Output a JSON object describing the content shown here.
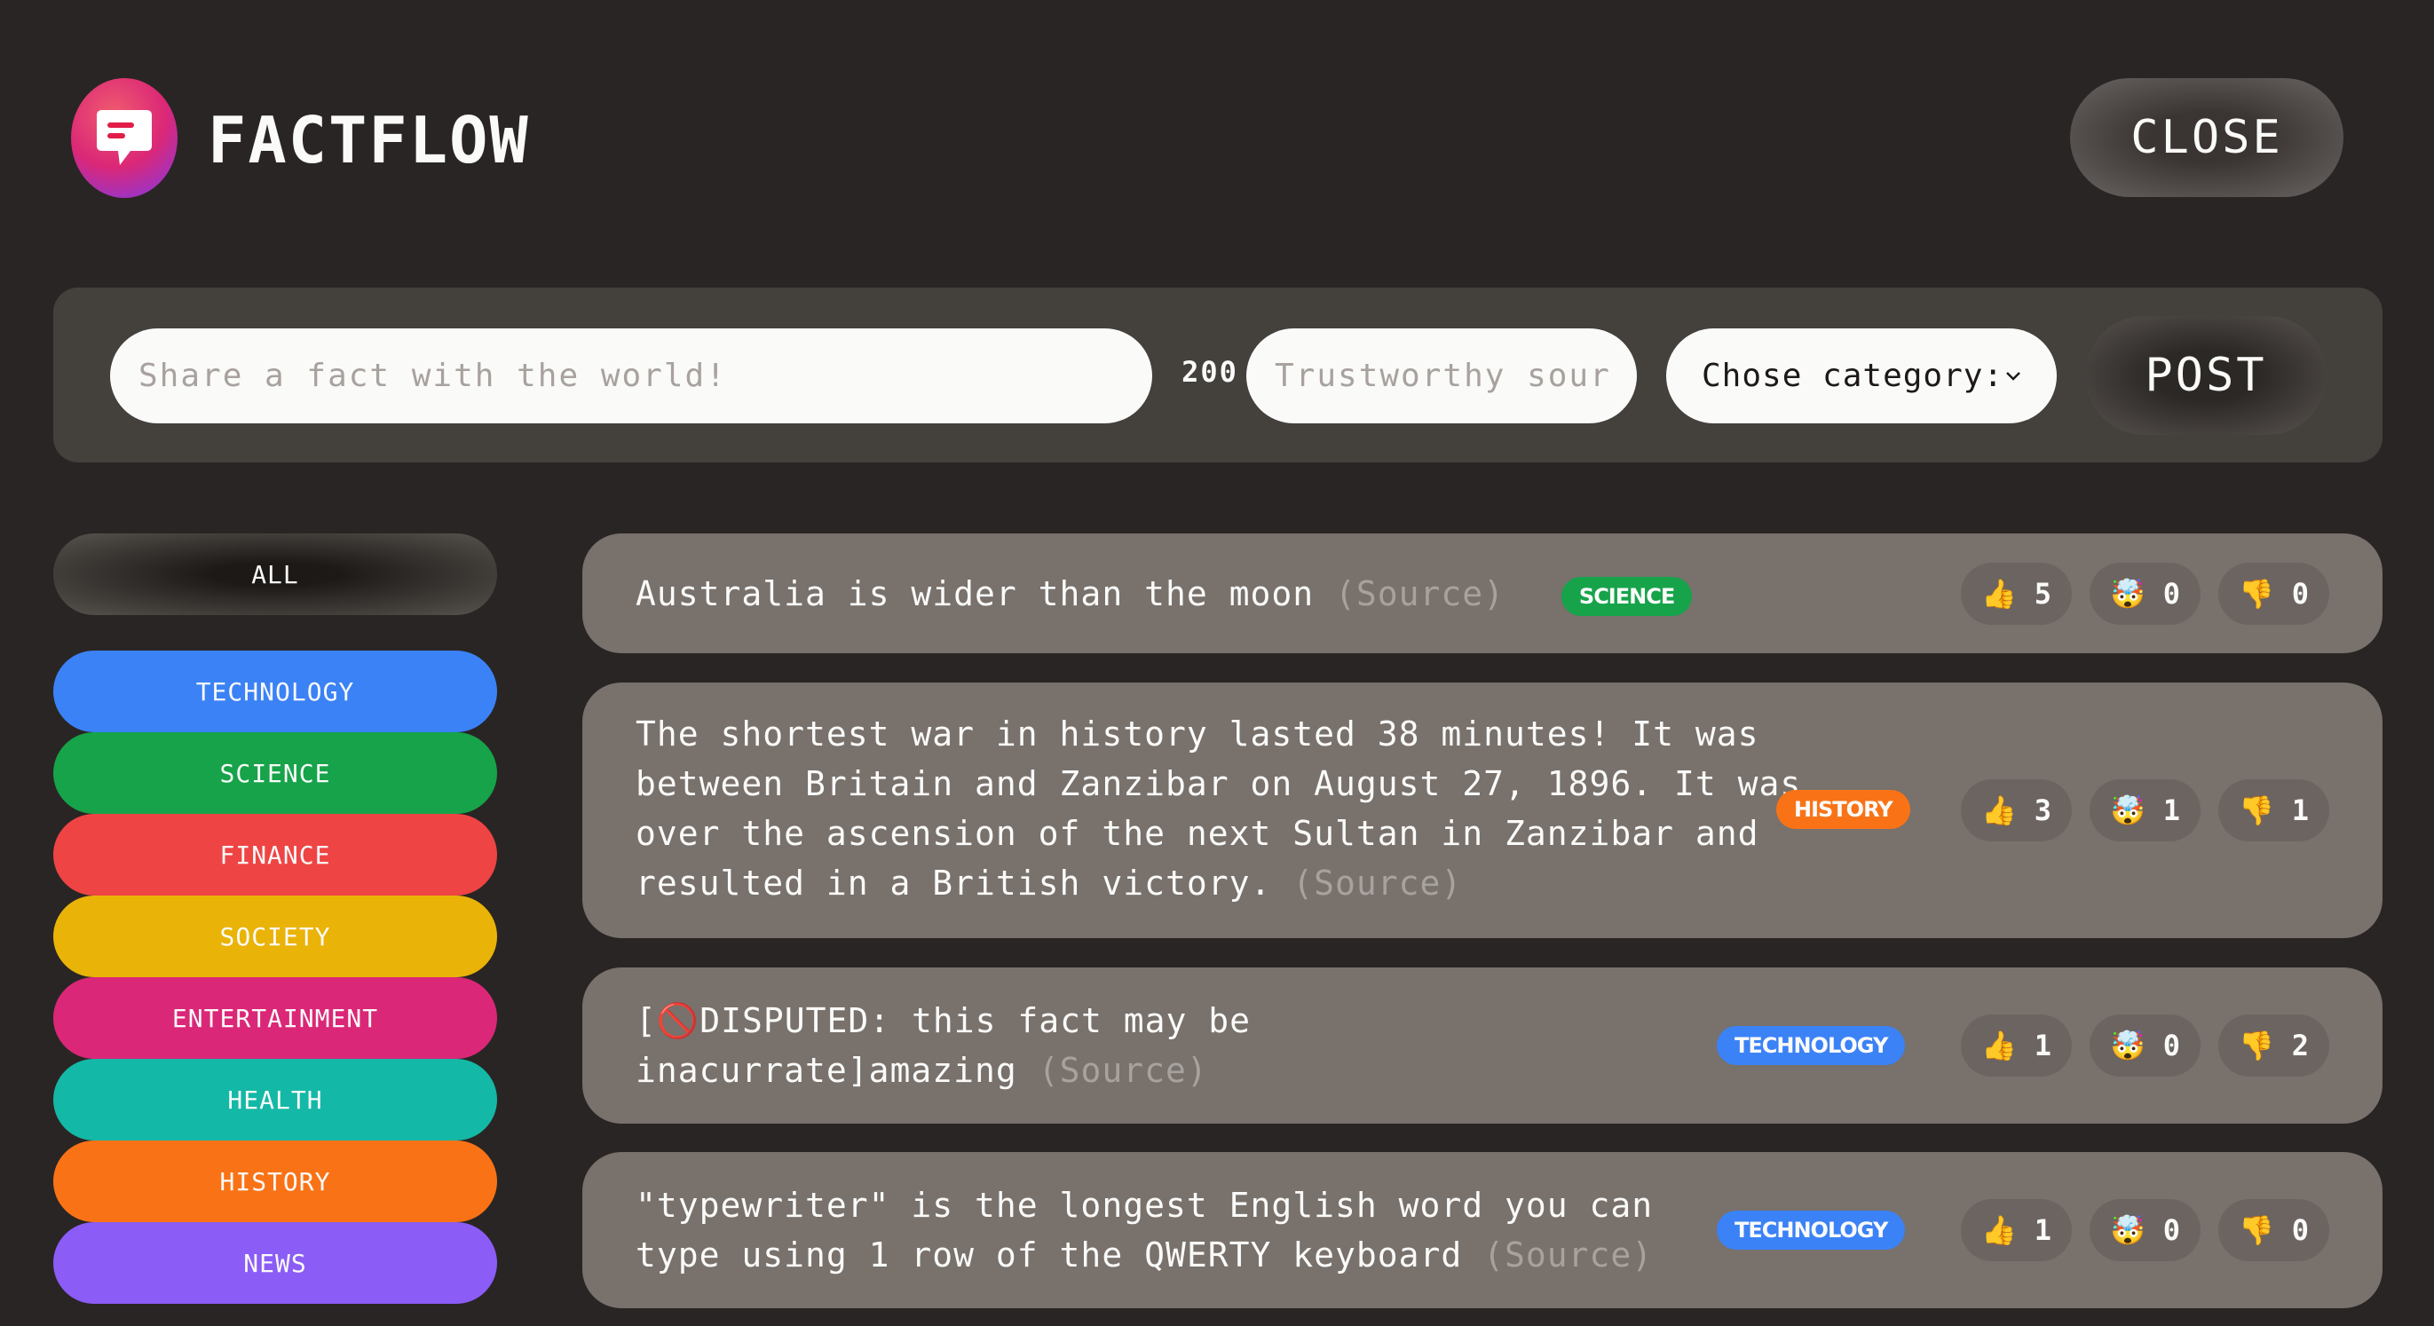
{
  "app": {
    "title": "FACTFLOW",
    "close_label": "CLOSE"
  },
  "form": {
    "fact_placeholder": "Share a fact with the world!",
    "char_count": "200",
    "source_placeholder": "Trustworthy source...",
    "category_label": "Chose category:",
    "post_label": "POST"
  },
  "categories": {
    "all": "ALL",
    "items": [
      {
        "label": "technology",
        "color": "#3b82f6"
      },
      {
        "label": "science",
        "color": "#16a34a"
      },
      {
        "label": "finance",
        "color": "#ef4444"
      },
      {
        "label": "society",
        "color": "#eab308"
      },
      {
        "label": "entertainment",
        "color": "#db2777"
      },
      {
        "label": "health",
        "color": "#14b8a6"
      },
      {
        "label": "history",
        "color": "#f97316"
      },
      {
        "label": "news",
        "color": "#8b5cf6"
      }
    ]
  },
  "facts": [
    {
      "text": "Australia is wider than the moon",
      "source": "(Source)",
      "tag": "SCIENCE",
      "tag_color": "#16a34a",
      "votes": {
        "interesting": "5",
        "mindblowing": "0",
        "false": "0"
      }
    },
    {
      "text": "The shortest war in history lasted 38 minutes! It was between Britain and Zanzibar on August 27, 1896. It was over the ascension of the next Sultan in Zanzibar and resulted in a British victory.",
      "source": "(Source)",
      "tag": "HISTORY",
      "tag_color": "#f97316",
      "votes": {
        "interesting": "3",
        "mindblowing": "1",
        "false": "1"
      }
    },
    {
      "text": "[🚫DISPUTED: this fact may be inacurrate]amazing",
      "source": "(Source)",
      "tag": "TECHNOLOGY",
      "tag_color": "#3b82f6",
      "votes": {
        "interesting": "1",
        "mindblowing": "0",
        "false": "2"
      }
    },
    {
      "text": "\"typewriter\" is the longest English word you can type using 1 row of the QWERTY keyboard",
      "source": "(Source)",
      "tag": "TECHNOLOGY",
      "tag_color": "#3b82f6",
      "votes": {
        "interesting": "1",
        "mindblowing": "0",
        "false": "0"
      }
    }
  ],
  "icons": {
    "logo": "chat-bubble-icon",
    "interesting": "thumbs-up-icon",
    "mindblowing": "mind-blown-icon",
    "false": "thumbs-down-icon",
    "select": "chevron-down-icon"
  }
}
